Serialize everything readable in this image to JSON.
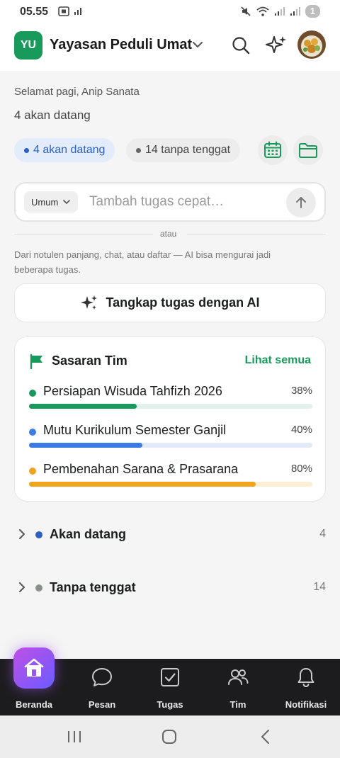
{
  "status_bar": {
    "time": "05.55",
    "battery": "1"
  },
  "header": {
    "org_initials": "YU",
    "org_name": "Yayasan Peduli Umat"
  },
  "greeting": "Selamat pagi, Anip Sanata",
  "upcoming_summary": "4 akan datang",
  "filters": {
    "upcoming_chip": "4 akan datang",
    "no_deadline_chip": "14 tanpa tenggat"
  },
  "quick_add": {
    "category": "Umum",
    "placeholder": "Tambah tugas cepat…"
  },
  "separator_text": "atau",
  "ai_hint": "Dari notulen panjang, chat, atau daftar — AI bisa mengurai jadi beberapa tugas.",
  "ai_button_label": "Tangkap tugas dengan AI",
  "team_goals": {
    "title": "Sasaran Tim",
    "see_all": "Lihat semua",
    "goals": [
      {
        "name": "Persiapan Wisuda Tahfizh 2026",
        "percent_label": "38%",
        "progress": 0.38,
        "color": "#179a5a",
        "track_color": "#e2f1e9"
      },
      {
        "name": "Mutu Kurikulum Semester Ganjil",
        "percent_label": "40%",
        "progress": 0.4,
        "color": "#3b7be6",
        "track_color": "#e3ebfb"
      },
      {
        "name": "Pembenahan Sarana & Prasarana",
        "percent_label": "80%",
        "progress": 0.8,
        "color": "#f0a31b",
        "track_color": "#fcefd6"
      }
    ]
  },
  "sections": [
    {
      "name": "Akan datang",
      "count": "4",
      "color": "#2c5fc4"
    },
    {
      "name": "Tanpa tenggat",
      "count": "14",
      "color": "#8a8f8c"
    }
  ],
  "bottom_nav": {
    "items": [
      {
        "label": "Beranda",
        "icon": "home-icon",
        "active": true
      },
      {
        "label": "Pesan",
        "icon": "chat-icon"
      },
      {
        "label": "Tugas",
        "icon": "checkbox-icon"
      },
      {
        "label": "Tim",
        "icon": "people-icon"
      },
      {
        "label": "Notifikasi",
        "icon": "bell-icon"
      }
    ]
  },
  "colors": {
    "brand_green": "#179a5a",
    "accent_blue": "#2c5fc4",
    "nav_active_gradient": [
      "#c04fe6",
      "#6a5cff"
    ]
  }
}
